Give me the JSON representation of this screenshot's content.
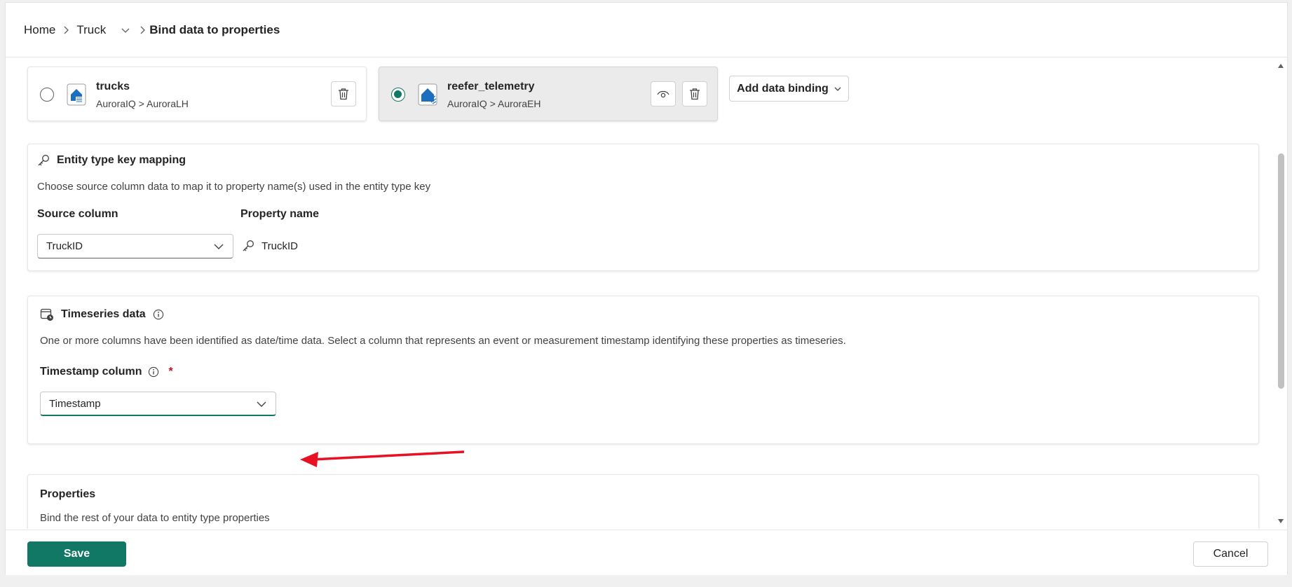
{
  "breadcrumb": {
    "home": "Home",
    "entity": "Truck",
    "current": "Bind data to properties"
  },
  "bindings": [
    {
      "name": "trucks",
      "path": "AuroraIQ > AuroraLH",
      "selected": false
    },
    {
      "name": "reefer_telemetry",
      "path": "AuroraIQ > AuroraEH",
      "selected": true
    }
  ],
  "add_binding_label": "Add data binding",
  "key_mapping": {
    "title": "Entity type key mapping",
    "description": "Choose source column data to map it to property name(s) used in the entity type key",
    "source_column_label": "Source column",
    "property_name_label": "Property name",
    "source_column_value": "TruckID",
    "property_name_value": "TruckID"
  },
  "timeseries": {
    "title": "Timeseries data",
    "description": "One or more columns have been identified as date/time data. Select a column that represents an event or measurement timestamp identifying these properties as timeseries.",
    "timestamp_label": "Timestamp column",
    "required_mark": "*",
    "timestamp_value": "Timestamp"
  },
  "properties": {
    "title": "Properties",
    "description": "Bind the rest of your data to entity type properties"
  },
  "footer": {
    "save_label": "Save",
    "cancel_label": "Cancel"
  },
  "colors": {
    "accent": "#117865",
    "annotation_arrow": "#e81123"
  }
}
